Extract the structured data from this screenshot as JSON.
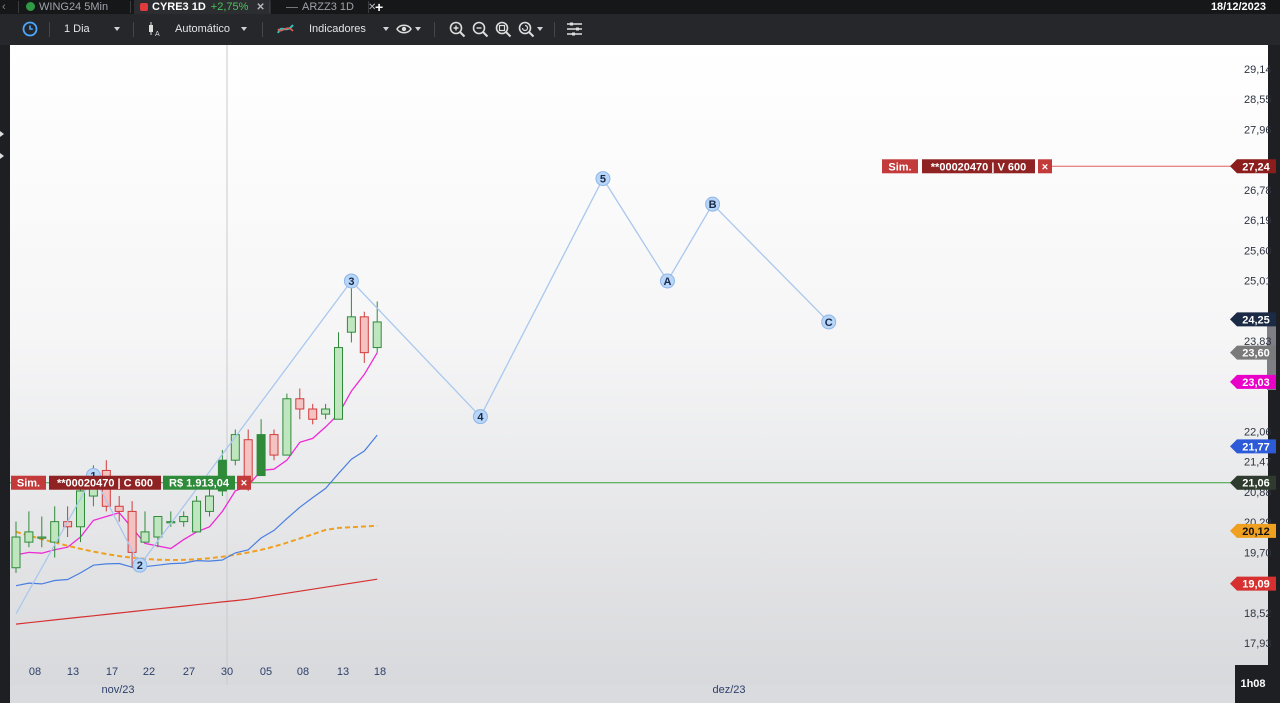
{
  "tabs": [
    {
      "label": "WING24 5Min",
      "icon": "brazil-flag-icon",
      "active": false
    },
    {
      "label": "CYRE3 1D",
      "change": "+2,75%",
      "icon": "lock-icon",
      "active": true
    },
    {
      "label": "ARZZ3 1D",
      "icon": "line-icon",
      "active": false
    }
  ],
  "date": "18/12/2023",
  "toolbar": {
    "timeframe": "1 Dia",
    "mode": "Automático",
    "indicators": "Indicadores"
  },
  "chart_data": {
    "type": "candlestick",
    "y_ticks": [
      "29,14",
      "28,55",
      "27,96",
      "26,78",
      "26,19",
      "25,60",
      "25,01",
      "23,83",
      "22,06",
      "21,47",
      "20,88",
      "20,29",
      "19,70",
      "18,52",
      "17,93"
    ],
    "x_ticks": [
      "08",
      "13",
      "17",
      "22",
      "27",
      "30",
      "05",
      "08",
      "13",
      "18"
    ],
    "x_groups": [
      "nov/23",
      "dez/23"
    ],
    "price_tags": [
      {
        "value": "27,24",
        "color": "#8b1d1d"
      },
      {
        "value": "24,25",
        "color": "#1b2a45"
      },
      {
        "value": "23,60",
        "color": "#7a7a7a"
      },
      {
        "value": "23,03",
        "color": "#e800c8"
      },
      {
        "value": "21,77",
        "color": "#2d5bd8"
      },
      {
        "value": "21,06",
        "color": "#2e3b2e"
      },
      {
        "value": "20,12",
        "color": "#f0a020"
      },
      {
        "value": "19,09",
        "color": "#d63030"
      }
    ],
    "candles": [
      {
        "o": 19.4,
        "h": 20.3,
        "l": 19.3,
        "c": 20.0
      },
      {
        "o": 19.9,
        "h": 20.5,
        "l": 19.8,
        "c": 20.1
      },
      {
        "o": 20.0,
        "h": 20.4,
        "l": 19.8,
        "c": 20.0
      },
      {
        "o": 19.9,
        "h": 20.6,
        "l": 19.6,
        "c": 20.3
      },
      {
        "o": 20.3,
        "h": 20.6,
        "l": 20.0,
        "c": 20.2
      },
      {
        "o": 20.2,
        "h": 21.0,
        "l": 19.9,
        "c": 20.9
      },
      {
        "o": 20.8,
        "h": 21.4,
        "l": 20.6,
        "c": 21.3
      },
      {
        "o": 21.3,
        "h": 21.5,
        "l": 20.5,
        "c": 20.6
      },
      {
        "o": 20.6,
        "h": 20.8,
        "l": 20.3,
        "c": 20.5
      },
      {
        "o": 20.5,
        "h": 20.7,
        "l": 19.4,
        "c": 19.7
      },
      {
        "o": 19.9,
        "h": 20.5,
        "l": 19.9,
        "c": 20.1
      },
      {
        "o": 20.0,
        "h": 20.4,
        "l": 19.8,
        "c": 20.4
      },
      {
        "o": 20.3,
        "h": 20.5,
        "l": 20.2,
        "c": 20.3
      },
      {
        "o": 20.3,
        "h": 20.5,
        "l": 20.2,
        "c": 20.4
      },
      {
        "o": 20.1,
        "h": 20.8,
        "l": 20.1,
        "c": 20.7
      },
      {
        "o": 20.5,
        "h": 21.2,
        "l": 20.4,
        "c": 20.8
      },
      {
        "o": 20.9,
        "h": 21.7,
        "l": 20.8,
        "c": 21.5
      },
      {
        "o": 21.5,
        "h": 22.1,
        "l": 21.4,
        "c": 22.0
      },
      {
        "o": 21.9,
        "h": 22.1,
        "l": 20.9,
        "c": 21.1
      },
      {
        "o": 21.2,
        "h": 22.3,
        "l": 21.2,
        "c": 22.0
      },
      {
        "o": 22.0,
        "h": 22.1,
        "l": 21.5,
        "c": 21.6
      },
      {
        "o": 21.6,
        "h": 22.8,
        "l": 21.6,
        "c": 22.7
      },
      {
        "o": 22.7,
        "h": 22.9,
        "l": 22.3,
        "c": 22.5
      },
      {
        "o": 22.5,
        "h": 22.6,
        "l": 22.2,
        "c": 22.3
      },
      {
        "o": 22.4,
        "h": 22.6,
        "l": 22.3,
        "c": 22.5
      },
      {
        "o": 22.3,
        "h": 24.0,
        "l": 22.3,
        "c": 23.7
      },
      {
        "o": 24.0,
        "h": 24.9,
        "l": 23.8,
        "c": 24.3
      },
      {
        "o": 24.3,
        "h": 24.4,
        "l": 23.4,
        "c": 23.6
      },
      {
        "o": 23.7,
        "h": 24.6,
        "l": 23.6,
        "c": 24.2
      }
    ],
    "waves": [
      {
        "label": "1",
        "i": 6,
        "v": 21.2
      },
      {
        "label": "2",
        "i": 9.6,
        "v": 19.45
      },
      {
        "label": "3",
        "i": 26,
        "v": 25.0
      },
      {
        "label": "4",
        "i": 36,
        "v": 22.35
      },
      {
        "label": "5",
        "i": 45.5,
        "v": 27.0
      },
      {
        "label": "A",
        "i": 50.5,
        "v": 25.0
      },
      {
        "label": "B",
        "i": 54,
        "v": 26.5
      },
      {
        "label": "C",
        "i": 63,
        "v": 24.2
      }
    ],
    "buy_order": {
      "tag": "Sim.",
      "id": "**00020470 | C 600",
      "result": "R$ 1.913,04",
      "price": 21.06
    },
    "sell_order": {
      "tag": "Sim.",
      "id": "**00020470 | V 600",
      "price": 27.24
    }
  },
  "time_remaining": "1h08"
}
